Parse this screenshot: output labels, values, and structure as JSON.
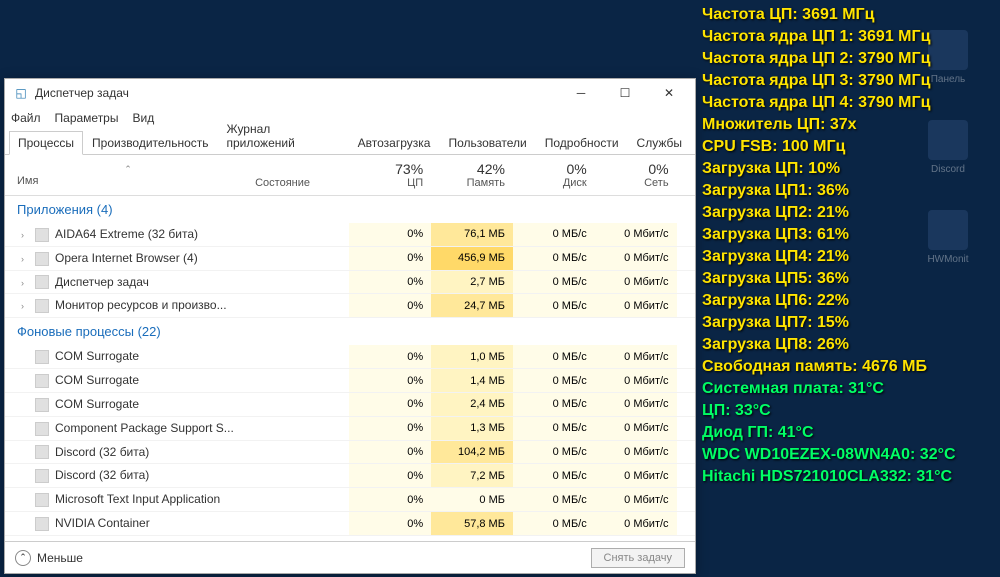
{
  "desktop": {
    "icons": [
      "Панель",
      "Discord",
      "HWMonit"
    ]
  },
  "sensors": {
    "yellow": [
      "Частота ЦП: 3691 МГц",
      "Частота ядра ЦП 1: 3691 МГц",
      "Частота ядра ЦП 2: 3790 МГц",
      "Частота ядра ЦП 3: 3790 МГц",
      "Частота ядра ЦП 4: 3790 МГц",
      "Множитель ЦП: 37x",
      "CPU FSB: 100 МГц",
      "Загрузка ЦП: 10%",
      "Загрузка ЦП1: 36%",
      "Загрузка ЦП2: 21%",
      "Загрузка ЦП3: 61%",
      "Загрузка ЦП4: 21%",
      "Загрузка ЦП5: 36%",
      "Загрузка ЦП6: 22%",
      "Загрузка ЦП7: 15%",
      "Загрузка ЦП8: 26%",
      "Свободная память: 4676 МБ"
    ],
    "green": [
      "Системная плата: 31°C",
      "ЦП: 33°C",
      "Диод ГП: 41°C",
      "WDC WD10EZEX-08WN4A0: 32°C",
      "Hitachi HDS721010CLA332: 31°C"
    ]
  },
  "tm": {
    "title": "Диспетчер задач",
    "menu": [
      "Файл",
      "Параметры",
      "Вид"
    ],
    "tabs": [
      "Процессы",
      "Производительность",
      "Журнал приложений",
      "Автозагрузка",
      "Пользователи",
      "Подробности",
      "Службы"
    ],
    "activeTab": 0,
    "cols": {
      "name": "Имя",
      "state": "Состояние",
      "cpu": {
        "pct": "73%",
        "lbl": "ЦП"
      },
      "mem": {
        "pct": "42%",
        "lbl": "Память"
      },
      "disk": {
        "pct": "0%",
        "lbl": "Диск"
      },
      "net": {
        "pct": "0%",
        "lbl": "Сеть"
      }
    },
    "groups": {
      "apps": "Приложения (4)",
      "bg": "Фоновые процессы (22)"
    },
    "apps": [
      {
        "name": "AIDA64 Extreme (32 бита)",
        "exp": true,
        "cpu": "0%",
        "mem": "76,1 МБ",
        "memHeat": 2,
        "disk": "0 МБ/с",
        "net": "0 Мбит/с"
      },
      {
        "name": "Opera Internet Browser (4)",
        "exp": true,
        "cpu": "0%",
        "mem": "456,9 МБ",
        "memHeat": 3,
        "disk": "0 МБ/с",
        "net": "0 Мбит/с"
      },
      {
        "name": "Диспетчер задач",
        "exp": true,
        "cpu": "0%",
        "mem": "2,7 МБ",
        "memHeat": 1,
        "disk": "0 МБ/с",
        "net": "0 Мбит/с"
      },
      {
        "name": "Монитор ресурсов и произво...",
        "exp": true,
        "cpu": "0%",
        "mem": "24,7 МБ",
        "memHeat": 2,
        "disk": "0 МБ/с",
        "net": "0 Мбит/с"
      }
    ],
    "bg": [
      {
        "name": "COM Surrogate",
        "cpu": "0%",
        "mem": "1,0 МБ",
        "memHeat": 1,
        "disk": "0 МБ/с",
        "net": "0 Мбит/с"
      },
      {
        "name": "COM Surrogate",
        "cpu": "0%",
        "mem": "1,4 МБ",
        "memHeat": 1,
        "disk": "0 МБ/с",
        "net": "0 Мбит/с"
      },
      {
        "name": "COM Surrogate",
        "cpu": "0%",
        "mem": "2,4 МБ",
        "memHeat": 1,
        "disk": "0 МБ/с",
        "net": "0 Мбит/с"
      },
      {
        "name": "Component Package Support S...",
        "cpu": "0%",
        "mem": "1,3 МБ",
        "memHeat": 1,
        "disk": "0 МБ/с",
        "net": "0 Мбит/с"
      },
      {
        "name": "Discord (32 бита)",
        "cpu": "0%",
        "mem": "104,2 МБ",
        "memHeat": 2,
        "disk": "0 МБ/с",
        "net": "0 Мбит/с"
      },
      {
        "name": "Discord (32 бита)",
        "cpu": "0%",
        "mem": "7,2 МБ",
        "memHeat": 1,
        "disk": "0 МБ/с",
        "net": "0 Мбит/с"
      },
      {
        "name": "Microsoft Text Input Application",
        "cpu": "0%",
        "mem": "0 МБ",
        "memHeat": 0,
        "disk": "0 МБ/с",
        "net": "0 Мбит/с"
      },
      {
        "name": "NVIDIA Container",
        "cpu": "0%",
        "mem": "57,8 МБ",
        "memHeat": 2,
        "disk": "0 МБ/с",
        "net": "0 Мбит/с"
      }
    ],
    "footer": {
      "fewer": "Меньше",
      "endTask": "Снять задачу"
    }
  }
}
